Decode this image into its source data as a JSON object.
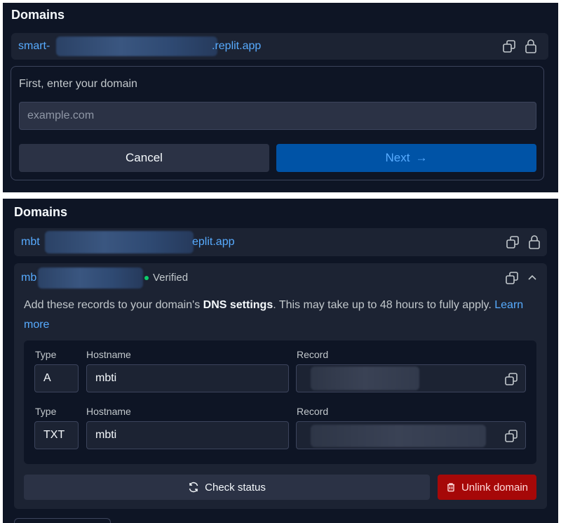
{
  "top": {
    "title": "Domains",
    "default_domain": {
      "prefix": "smart-",
      "suffix": ".replit.app"
    },
    "form": {
      "label": "First, enter your domain",
      "placeholder": "example.com",
      "cancel_label": "Cancel",
      "next_label": "Next",
      "next_arrow": "→"
    }
  },
  "bottom": {
    "title": "Domains",
    "default_domain": {
      "prefix": "mbt",
      "suffix": "eplit.app"
    },
    "custom_domain": {
      "prefix": "mb",
      "status": "Verified",
      "description_pre": "Add these records to your domain's",
      "description_bold": "DNS settings",
      "description_post": ". This may take up to 48 hours to fully apply.",
      "learn_more": "Learn more"
    },
    "records": [
      {
        "type_label": "Type",
        "hostname_label": "Hostname",
        "record_label": "Record",
        "type": "A",
        "hostname": "mbti",
        "record": ""
      },
      {
        "type_label": "Type",
        "hostname_label": "Hostname",
        "record_label": "Record",
        "type": "TXT",
        "hostname": "mbti",
        "record": ""
      }
    ],
    "check_status_label": "Check status",
    "unlink_label": "Unlink domain"
  },
  "colors": {
    "background": "#0e1525",
    "surface": "#1c2333",
    "accent": "#57abff",
    "primary": "#0053a6",
    "danger": "#a60808",
    "success": "#0cce6b"
  },
  "icons": {
    "copy": "copy-icon",
    "lock": "lock-icon",
    "chevron": "chevron-up-icon",
    "refresh": "refresh-icon",
    "trash": "trash-icon",
    "arrow": "arrow-right-icon"
  }
}
